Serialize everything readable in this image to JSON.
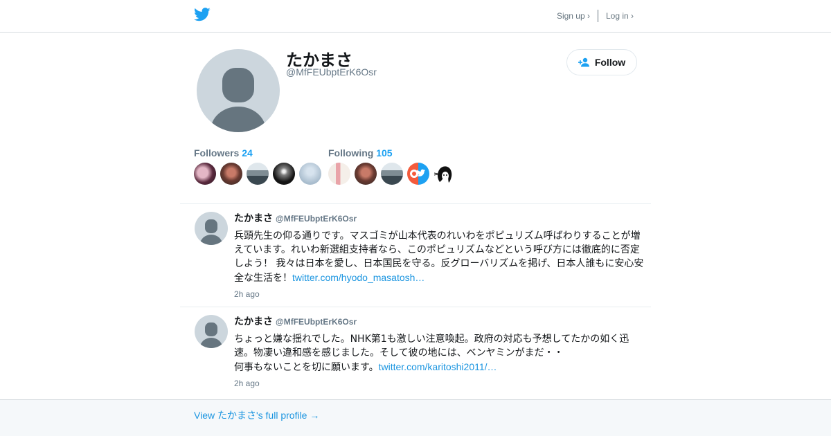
{
  "topbar": {
    "signup_label": "Sign up ›",
    "login_label": "Log in ›"
  },
  "profile": {
    "name": "たかまさ",
    "handle": "@MfFEUbptErK6Osr",
    "follow_label": "Follow",
    "followers_label": "Followers",
    "followers_count": "24",
    "following_label": "Following",
    "following_count": "105"
  },
  "tweets": [
    {
      "name": "たかまさ",
      "handle": "@MfFEUbptErK6Osr",
      "lines": [
        "兵頭先生の仰る通りです。マスゴミが山本代表のれいわをポピュリズム呼ばわりすることが増",
        "えています。れいわ新選組支持者なら、このポピュリズムなどという呼び方には徹底的に否定",
        "しよう！ 我々は日本を愛し、日本国民を守る。反グローバリズムを掲げ、日本人誰もに安心安",
        "全な生活を！"
      ],
      "link": "twitter.com/hyodo_masatosh…",
      "time": "2h ago"
    },
    {
      "name": "たかまさ",
      "handle": "@MfFEUbptErK6Osr",
      "lines": [
        "ちょっと嫌な揺れでした。NHK第1も激しい注意喚起。政府の対応も予想してたかの如く迅",
        "速。物凄い違和感を感じました。そして彼の地には、ベンヤミンがまだ・・",
        "何事もないことを切に願います。"
      ],
      "link": "twitter.com/karitoshi2011/…",
      "time": "2h ago"
    }
  ],
  "footer": {
    "full_profile_label": "View たかまさ's full profile →"
  },
  "colors": {
    "accent": "#1da1f2",
    "link": "#1b95e0",
    "muted": "#657786",
    "avatar_bg": "#ccd6dd",
    "avatar_fg": "#66757f"
  }
}
